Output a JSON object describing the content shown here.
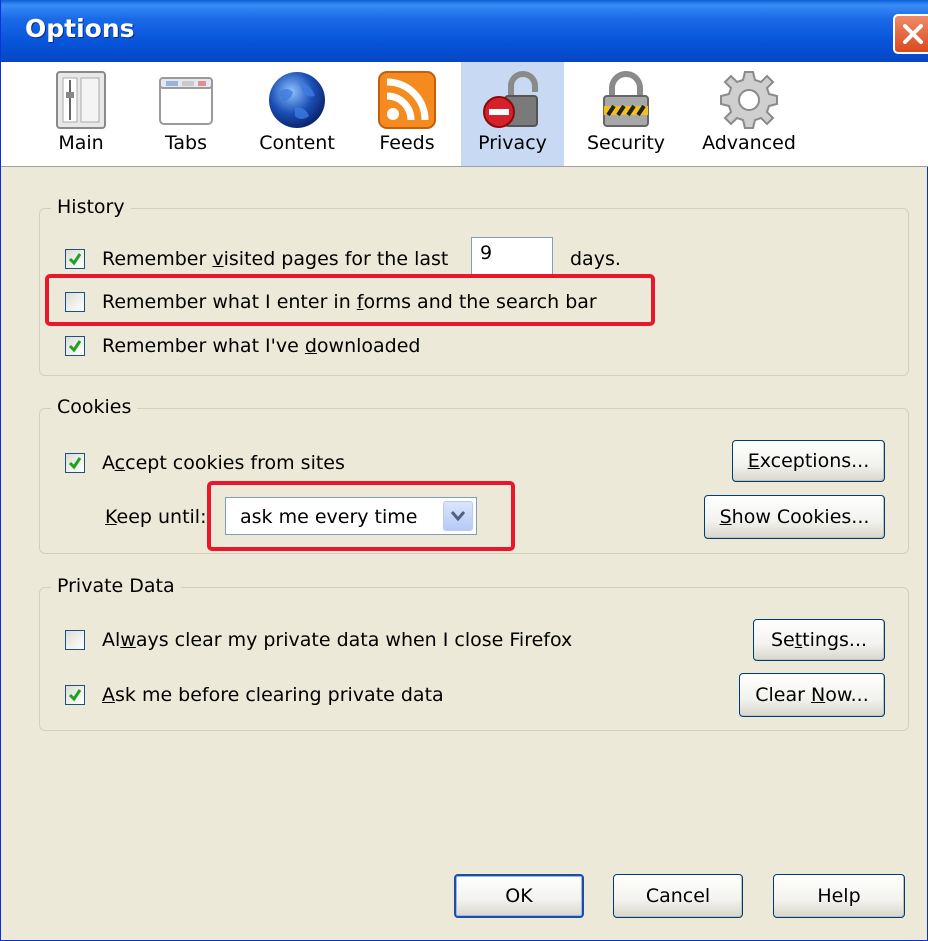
{
  "window": {
    "title": "Options"
  },
  "tabs": [
    {
      "label": "Main",
      "icon": "main-icon"
    },
    {
      "label": "Tabs",
      "icon": "tabs-icon"
    },
    {
      "label": "Content",
      "icon": "content-globe-icon"
    },
    {
      "label": "Feeds",
      "icon": "feeds-rss-icon"
    },
    {
      "label": "Privacy",
      "icon": "privacy-lock-icon",
      "selected": true
    },
    {
      "label": "Security",
      "icon": "security-padlock-icon"
    },
    {
      "label": "Advanced",
      "icon": "advanced-gear-icon"
    }
  ],
  "history": {
    "legend": "History",
    "visited": {
      "checked": true,
      "pre": "Remember ",
      "key": "v",
      "post": "isited pages for the last",
      "days_value": "9",
      "days_label": "days."
    },
    "forms": {
      "checked": false,
      "pre": "Remember what I enter in ",
      "key": "f",
      "post": "orms and the search bar"
    },
    "downloads": {
      "checked": true,
      "pre": "Remember what I've ",
      "key": "d",
      "post": "ownloaded"
    }
  },
  "cookies": {
    "legend": "Cookies",
    "accept": {
      "checked": true,
      "pre": "A",
      "key": "c",
      "post": "cept cookies from sites"
    },
    "keep_until": {
      "key": "K",
      "post": "eep until:",
      "value": "ask me every time"
    },
    "exceptions_button": {
      "key": "E",
      "post": "xceptions..."
    },
    "show_cookies_button": {
      "key": "S",
      "post": "how Cookies..."
    }
  },
  "private_data": {
    "legend": "Private Data",
    "always_clear": {
      "checked": false,
      "pre": "Al",
      "key": "w",
      "post": "ays clear my private data when I close Firefox"
    },
    "ask_before": {
      "checked": true,
      "pre": "",
      "key": "A",
      "post": "sk me before clearing private data"
    },
    "settings_button": {
      "pre": "Se",
      "key": "t",
      "post": "tings..."
    },
    "clear_now_button": {
      "pre": "Clear ",
      "key": "N",
      "post": "ow..."
    }
  },
  "buttons": {
    "ok": "OK",
    "cancel": "Cancel",
    "help": "Help"
  },
  "colors": {
    "titlebar": "#0653d8",
    "dialog_bg": "#ece9d8",
    "highlight": "#e8182a",
    "selected_tab": "#c7d9f3"
  }
}
